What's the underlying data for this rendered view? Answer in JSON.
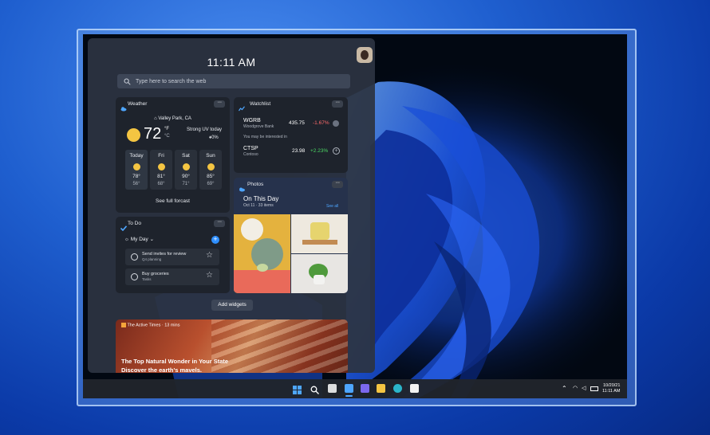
{
  "clock": "11:11 AM",
  "search": {
    "placeholder": "Type here to search the web"
  },
  "weather": {
    "title": "Weather",
    "location": "Valley Park, CA",
    "temp": "72",
    "unit_f": "°F",
    "unit_c": "°C",
    "condition": "Strong UV today",
    "precip": "0%",
    "days": [
      {
        "name": "Today",
        "high": "78°",
        "low": "56°"
      },
      {
        "name": "Fri",
        "high": "81°",
        "low": "68°"
      },
      {
        "name": "Sat",
        "high": "90°",
        "low": "71°"
      },
      {
        "name": "Sun",
        "high": "85°",
        "low": "69°"
      }
    ],
    "link": "See full forcast"
  },
  "watchlist": {
    "title": "Watchlist",
    "stocks": [
      {
        "symbol": "WGRB",
        "company": "Woodgrove Bank",
        "price": "435.75",
        "change": "-1.67%"
      },
      {
        "symbol": "CTSP",
        "company": "Contoso",
        "price": "23.98",
        "change": "+2.23%"
      }
    ],
    "suggestion": "You may be interested in"
  },
  "photos": {
    "title": "Photos",
    "heading": "On This Day",
    "date": "Oct 11 · 33 items",
    "see_all": "See all"
  },
  "todo": {
    "title": "To Do",
    "list": "My Day",
    "items": [
      {
        "text": "Send invites for review",
        "sub": "Q4 planning"
      },
      {
        "text": "Buy groceries",
        "sub": "Tasks"
      }
    ]
  },
  "add_widgets": "Add widgets",
  "news": {
    "source": "The Active Times · 13 mins",
    "headline_1": "The Top Natural Wonder in Your State",
    "headline_2": "Discover the earth's mavels."
  },
  "taskbar": {
    "date": "10/20/21",
    "time": "11:11 AM"
  },
  "colors": {
    "accent": "#2f8fff",
    "negative": "#ff6b6b",
    "positive": "#4cd964",
    "sun": "#f4c542"
  }
}
